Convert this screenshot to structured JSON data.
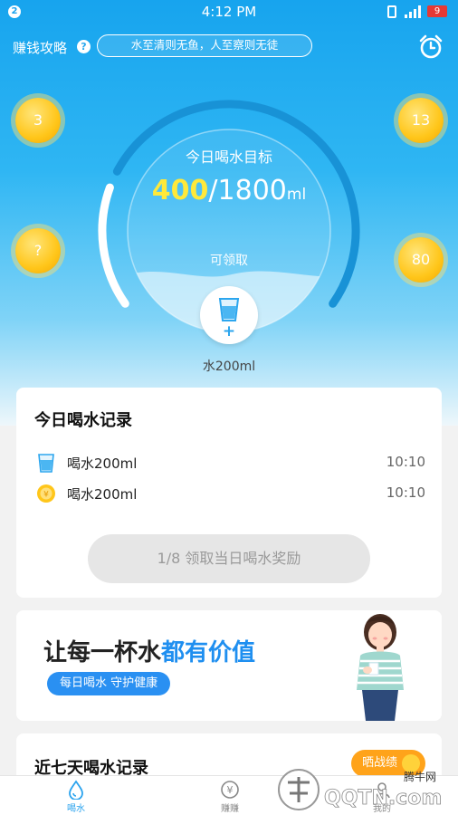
{
  "status_bar": {
    "notification_count": "2",
    "time": "4:12 PM",
    "battery": "9"
  },
  "header": {
    "guide_label": "赚钱攻略",
    "help_icon": "?",
    "motto": "水至清则无鱼，人至察则无徒",
    "alarm_icon": "alarm-clock-icon"
  },
  "coins": {
    "top_left": "3",
    "mid_left": "?",
    "top_right": "13",
    "mid_right": "80"
  },
  "goal": {
    "title": "今日喝水目标",
    "current": "400",
    "separator_target": "/1800",
    "unit": "ml",
    "progress": 0.22,
    "claimable_label": "可领取",
    "drink_plus": "+",
    "drink_amount": "水200ml"
  },
  "records": {
    "title": "今日喝水记录",
    "items": [
      {
        "icon": "water-cup-icon",
        "label": "喝水200ml",
        "time": "10:10"
      },
      {
        "icon": "coin-icon",
        "label": "喝水200ml",
        "time": "10:10"
      }
    ],
    "claim_button": "1/8 领取当日喝水奖励"
  },
  "banner": {
    "title_part1": "让每一杯水",
    "title_part2": "都有价值",
    "tag": "每日喝水 守护健康"
  },
  "week": {
    "title": "近七天喝水记录",
    "share_button": "晒战绩"
  },
  "nav": [
    {
      "label": "喝水",
      "icon": "water-drop-icon",
      "active": true
    },
    {
      "label": "赚赚",
      "icon": "yuan-coin-icon",
      "active": false
    },
    {
      "label": "我的",
      "icon": "user-icon",
      "active": false
    }
  ],
  "watermark": {
    "site_cn": "腾牛网",
    "site": "QQTN.com"
  },
  "colors": {
    "accent": "#2aa3ee",
    "highlight": "#ffe93a",
    "share": "#ffa31a",
    "banner_blue": "#1f8ff0"
  }
}
